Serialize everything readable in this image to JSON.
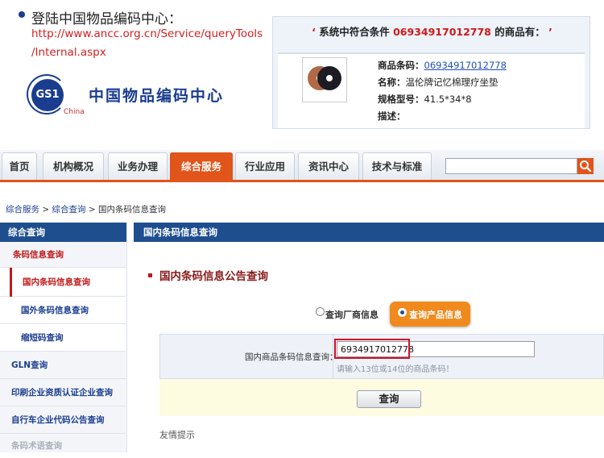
{
  "instructions": {
    "title": "登陆中国物品编码中心：",
    "url_line1": "http://www.ancc.org.cn/Service/queryTools",
    "url_line2": "/Internal.aspx"
  },
  "logo": {
    "gs1": "GS1",
    "china": "China",
    "org_name": "中国物品编码中心"
  },
  "result": {
    "prefix": "系统中符合条件",
    "code": "06934917012778",
    "suffix": "的商品有：",
    "fields": [
      {
        "label": "商品条码：",
        "value": "06934917012778"
      },
      {
        "label": "名称：",
        "value": "温伦牌记忆棉理疗坐垫"
      },
      {
        "label": "规格型号：",
        "value": "41.5*34*8"
      },
      {
        "label": "描述：",
        "value": ""
      }
    ]
  },
  "nav": {
    "items": [
      "首页",
      "机构概况",
      "业务办理",
      "综合服务",
      "行业应用",
      "资讯中心",
      "技术与标准"
    ],
    "active_index": 3,
    "search_placeholder": ""
  },
  "breadcrumb": {
    "items": [
      "综合服务",
      "综合查询",
      "国内条码信息查询"
    ],
    "separator": ">"
  },
  "sidebar": {
    "header": "综合查询",
    "items": [
      {
        "label": "条码信息查询"
      },
      {
        "label": "国内条码信息查询"
      },
      {
        "label": "国外条码信息查询"
      },
      {
        "label": "缩短码查询"
      },
      {
        "label": "GLN查询"
      },
      {
        "label": "印刷企业资质认证企业查询"
      },
      {
        "label": "自行车企业代码公告查询"
      },
      {
        "label": "条码术语查询"
      }
    ]
  },
  "main": {
    "header": "国内条码信息查询",
    "section_title": "国内条码信息公告查询",
    "radio_options": [
      {
        "label": "查询厂商信息",
        "selected": false
      },
      {
        "label": "查询产品信息",
        "selected": true
      }
    ],
    "field_label": "国内商品条码信息查询：",
    "field_value": "6934917012778",
    "field_hint": "请输入13位或14位的商品条码！",
    "submit_label": "查询",
    "friendly_tip": "友情提示"
  },
  "colors": {
    "accent_orange": "#e1541a",
    "nav_blue": "#1f4e8f",
    "link_red": "#d02020",
    "highlight_red": "#d0102a"
  }
}
